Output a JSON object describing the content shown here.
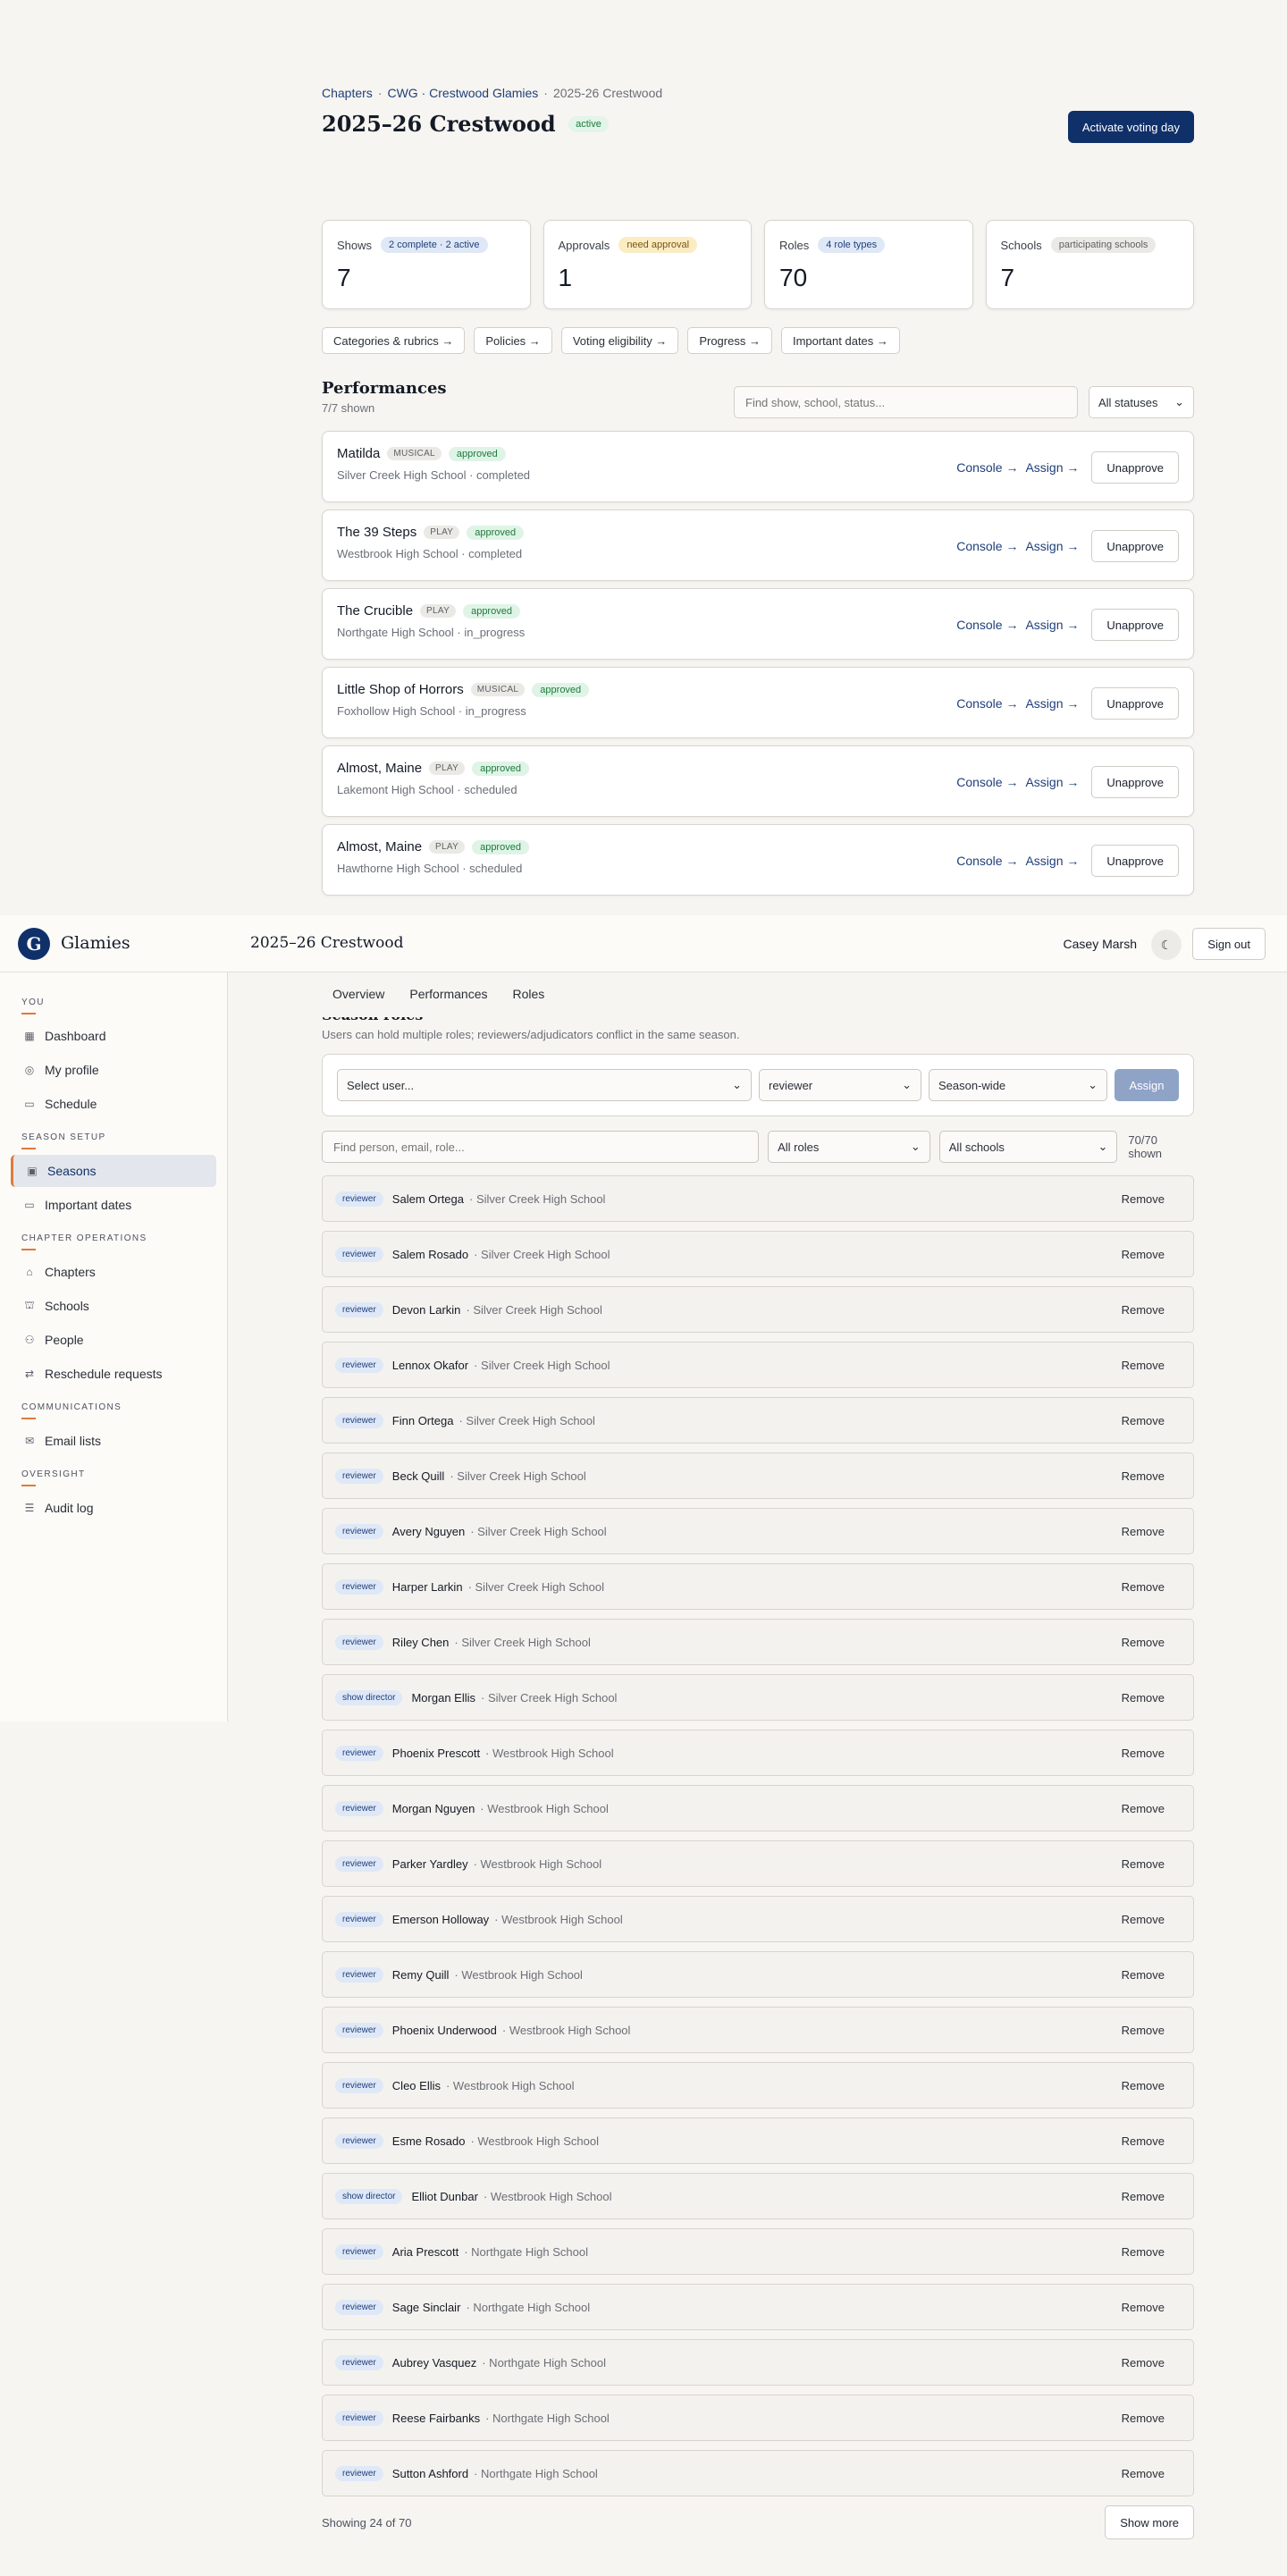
{
  "breadcrumb": [
    "Chapters",
    "CWG · Crestwood Glamies",
    "2025-26 Crestwood"
  ],
  "breadcrumb_sep": "·",
  "page": {
    "title": "2025–26 Crestwood",
    "status": "active",
    "primary_action": "Activate voting day"
  },
  "stats": [
    {
      "label": "Shows",
      "pill": "2 complete · 2 active",
      "value": "7"
    },
    {
      "label": "Approvals",
      "pill": "need approval",
      "value": "1"
    },
    {
      "label": "Roles",
      "pill": "4 role types",
      "value": "70"
    },
    {
      "label": "Schools",
      "pill": "participating schools",
      "value": "7"
    }
  ],
  "quick_links": [
    "Categories & rubrics →",
    "Policies →",
    "Voting eligibility →",
    "Progress →",
    "Important dates →"
  ],
  "performances": {
    "title": "Performances",
    "shown": "7/7 shown",
    "search_placeholder": "Find show, school, status...",
    "status_filter": "All statuses",
    "console_label": "Console →",
    "assign_label": "Assign →",
    "unapprove_label": "Unapprove",
    "rows": [
      {
        "name": "Matilda",
        "kind": "MUSICAL",
        "status": "approved",
        "meta": "Silver Creek High School · completed"
      },
      {
        "name": "The 39 Steps",
        "kind": "PLAY",
        "status": "approved",
        "meta": "Westbrook High School · completed"
      },
      {
        "name": "The Crucible",
        "kind": "PLAY",
        "status": "approved",
        "meta": "Northgate High School · in_progress"
      },
      {
        "name": "Little Shop of Horrors",
        "kind": "MUSICAL",
        "status": "approved",
        "meta": "Foxhollow High School · in_progress"
      },
      {
        "name": "Almost, Maine",
        "kind": "PLAY",
        "status": "approved",
        "meta": "Lakemont High School · scheduled"
      },
      {
        "name": "Almost, Maine",
        "kind": "PLAY",
        "status": "approved",
        "meta": "Hawthorne High School · scheduled"
      }
    ]
  },
  "topbar": {
    "brand": "Glamies",
    "logo_letter": "G",
    "title": "2025–26 Crestwood",
    "user": "Casey Marsh",
    "signout": "Sign out"
  },
  "sidebar": {
    "groups": [
      {
        "label": "YOU",
        "items": [
          {
            "label": "Dashboard",
            "icon": "grid-icon"
          },
          {
            "label": "My profile",
            "icon": "user-circle-icon"
          },
          {
            "label": "Schedule",
            "icon": "calendar-icon"
          }
        ]
      },
      {
        "label": "SEASON SETUP",
        "items": [
          {
            "label": "Seasons",
            "icon": "calendar-check-icon",
            "active": true
          },
          {
            "label": "Important dates",
            "icon": "calendar-icon"
          }
        ]
      },
      {
        "label": "CHAPTER OPERATIONS",
        "items": [
          {
            "label": "Chapters",
            "icon": "building-icon"
          },
          {
            "label": "Schools",
            "icon": "school-icon"
          },
          {
            "label": "People",
            "icon": "people-icon"
          },
          {
            "label": "Reschedule requests",
            "icon": "swap-icon"
          }
        ]
      },
      {
        "label": "COMMUNICATIONS",
        "items": [
          {
            "label": "Email lists",
            "icon": "mail-icon"
          }
        ]
      },
      {
        "label": "OVERSIGHT",
        "items": [
          {
            "label": "Audit log",
            "icon": "log-icon"
          }
        ]
      }
    ]
  },
  "tabs": [
    "Overview",
    "Performances",
    "Roles"
  ],
  "roles": {
    "title": "Season roles",
    "description": "Users can hold multiple roles; reviewers/adjudicators conflict in the same season.",
    "user_select": "Select user...",
    "role_select": "reviewer",
    "scope_select": "Season-wide",
    "assign_label": "Assign",
    "filter_placeholder": "Find person, email, role...",
    "roles_filter": "All roles",
    "schools_filter": "All schools",
    "shown": "70/70 shown",
    "remove_label": "Remove",
    "showing": "Showing 24 of 70",
    "show_more": "Show more",
    "rows": [
      {
        "role": "reviewer",
        "name": "Salem Ortega",
        "school": "· Silver Creek High School"
      },
      {
        "role": "reviewer",
        "name": "Salem Rosado",
        "school": "· Silver Creek High School"
      },
      {
        "role": "reviewer",
        "name": "Devon Larkin",
        "school": "· Silver Creek High School"
      },
      {
        "role": "reviewer",
        "name": "Lennox Okafor",
        "school": "· Silver Creek High School"
      },
      {
        "role": "reviewer",
        "name": "Finn Ortega",
        "school": "· Silver Creek High School"
      },
      {
        "role": "reviewer",
        "name": "Beck Quill",
        "school": "· Silver Creek High School"
      },
      {
        "role": "reviewer",
        "name": "Avery Nguyen",
        "school": "· Silver Creek High School"
      },
      {
        "role": "reviewer",
        "name": "Harper Larkin",
        "school": "· Silver Creek High School"
      },
      {
        "role": "reviewer",
        "name": "Riley Chen",
        "school": "· Silver Creek High School"
      },
      {
        "role": "show director",
        "name": "Morgan Ellis",
        "school": "· Silver Creek High School"
      },
      {
        "role": "reviewer",
        "name": "Phoenix Prescott",
        "school": "· Westbrook High School"
      },
      {
        "role": "reviewer",
        "name": "Morgan Nguyen",
        "school": "· Westbrook High School"
      },
      {
        "role": "reviewer",
        "name": "Parker Yardley",
        "school": "· Westbrook High School"
      },
      {
        "role": "reviewer",
        "name": "Emerson Holloway",
        "school": "· Westbrook High School"
      },
      {
        "role": "reviewer",
        "name": "Remy Quill",
        "school": "· Westbrook High School"
      },
      {
        "role": "reviewer",
        "name": "Phoenix Underwood",
        "school": "· Westbrook High School"
      },
      {
        "role": "reviewer",
        "name": "Cleo Ellis",
        "school": "· Westbrook High School"
      },
      {
        "role": "reviewer",
        "name": "Esme Rosado",
        "school": "· Westbrook High School"
      },
      {
        "role": "show director",
        "name": "Elliot Dunbar",
        "school": "· Westbrook High School"
      },
      {
        "role": "reviewer",
        "name": "Aria Prescott",
        "school": "· Northgate High School"
      },
      {
        "role": "reviewer",
        "name": "Sage Sinclair",
        "school": "· Northgate High School"
      },
      {
        "role": "reviewer",
        "name": "Aubrey Vasquez",
        "school": "· Northgate High School"
      },
      {
        "role": "reviewer",
        "name": "Reese Fairbanks",
        "school": "· Northgate High School"
      },
      {
        "role": "reviewer",
        "name": "Sutton Ashford",
        "school": "· Northgate High School"
      }
    ]
  }
}
